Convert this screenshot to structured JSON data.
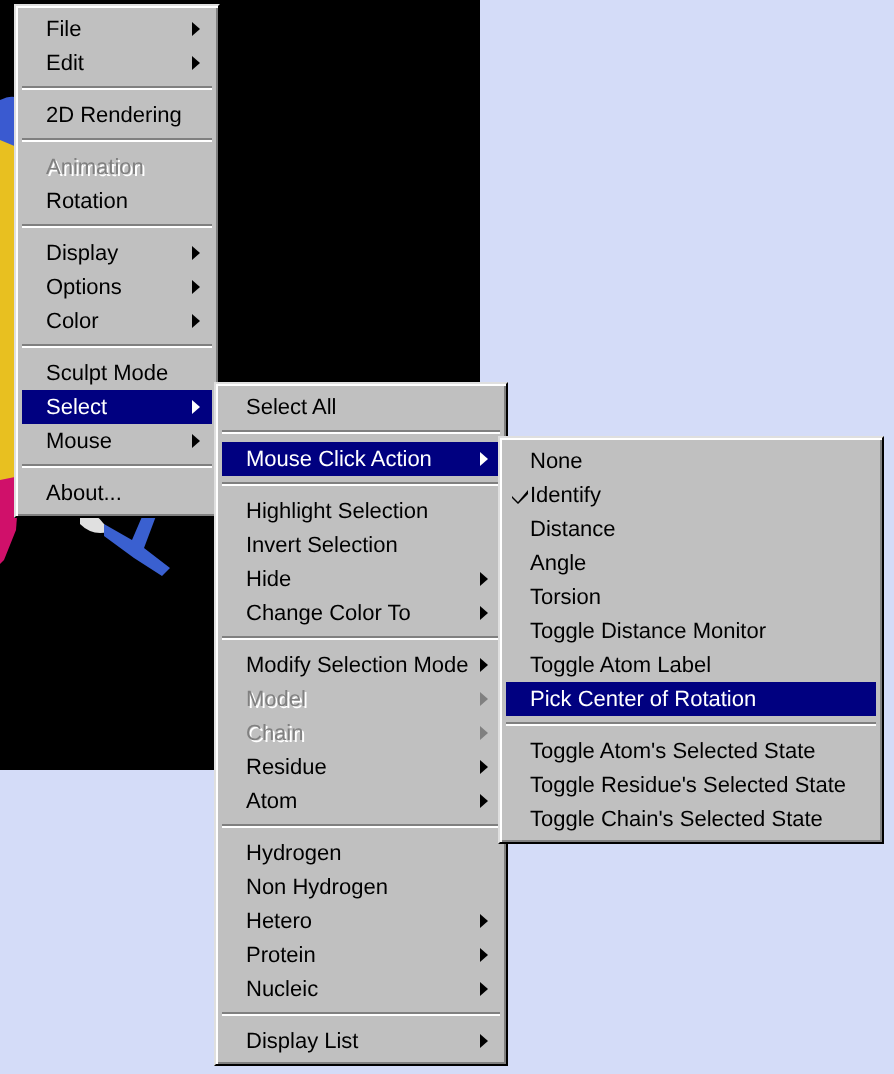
{
  "menus": [
    {
      "items": [
        {
          "kind": "item",
          "label": "File",
          "submenu": true,
          "disabled": false,
          "selected": false
        },
        {
          "kind": "item",
          "label": "Edit",
          "submenu": true,
          "disabled": false,
          "selected": false
        },
        {
          "kind": "separator"
        },
        {
          "kind": "item",
          "label": "2D Rendering",
          "submenu": false,
          "disabled": false,
          "selected": false
        },
        {
          "kind": "separator"
        },
        {
          "kind": "item",
          "label": "Animation",
          "submenu": false,
          "disabled": true,
          "selected": false
        },
        {
          "kind": "item",
          "label": "Rotation",
          "submenu": false,
          "disabled": false,
          "selected": false
        },
        {
          "kind": "separator"
        },
        {
          "kind": "item",
          "label": "Display",
          "submenu": true,
          "disabled": false,
          "selected": false
        },
        {
          "kind": "item",
          "label": "Options",
          "submenu": true,
          "disabled": false,
          "selected": false
        },
        {
          "kind": "item",
          "label": "Color",
          "submenu": true,
          "disabled": false,
          "selected": false
        },
        {
          "kind": "separator"
        },
        {
          "kind": "item",
          "label": "Sculpt Mode",
          "submenu": false,
          "disabled": false,
          "selected": false
        },
        {
          "kind": "item",
          "label": "Select",
          "submenu": true,
          "disabled": false,
          "selected": true
        },
        {
          "kind": "item",
          "label": "Mouse",
          "submenu": true,
          "disabled": false,
          "selected": false
        },
        {
          "kind": "separator"
        },
        {
          "kind": "item",
          "label": "About...",
          "submenu": false,
          "disabled": false,
          "selected": false
        }
      ]
    },
    {
      "items": [
        {
          "kind": "item",
          "label": "Select All",
          "submenu": false,
          "disabled": false,
          "selected": false
        },
        {
          "kind": "separator"
        },
        {
          "kind": "item",
          "label": "Mouse Click Action",
          "submenu": true,
          "disabled": false,
          "selected": true
        },
        {
          "kind": "separator"
        },
        {
          "kind": "item",
          "label": "Highlight Selection",
          "submenu": false,
          "disabled": false,
          "selected": false
        },
        {
          "kind": "item",
          "label": "Invert Selection",
          "submenu": false,
          "disabled": false,
          "selected": false
        },
        {
          "kind": "item",
          "label": "Hide",
          "submenu": true,
          "disabled": false,
          "selected": false
        },
        {
          "kind": "item",
          "label": "Change Color To",
          "submenu": true,
          "disabled": false,
          "selected": false
        },
        {
          "kind": "separator"
        },
        {
          "kind": "item",
          "label": "Modify Selection Mode",
          "submenu": true,
          "disabled": false,
          "selected": false
        },
        {
          "kind": "item",
          "label": "Model",
          "submenu": true,
          "disabled": true,
          "selected": false
        },
        {
          "kind": "item",
          "label": "Chain",
          "submenu": true,
          "disabled": true,
          "selected": false
        },
        {
          "kind": "item",
          "label": "Residue",
          "submenu": true,
          "disabled": false,
          "selected": false
        },
        {
          "kind": "item",
          "label": "Atom",
          "submenu": true,
          "disabled": false,
          "selected": false
        },
        {
          "kind": "separator"
        },
        {
          "kind": "item",
          "label": "Hydrogen",
          "submenu": false,
          "disabled": false,
          "selected": false
        },
        {
          "kind": "item",
          "label": "Non Hydrogen",
          "submenu": false,
          "disabled": false,
          "selected": false
        },
        {
          "kind": "item",
          "label": "Hetero",
          "submenu": true,
          "disabled": false,
          "selected": false
        },
        {
          "kind": "item",
          "label": "Protein",
          "submenu": true,
          "disabled": false,
          "selected": false
        },
        {
          "kind": "item",
          "label": "Nucleic",
          "submenu": true,
          "disabled": false,
          "selected": false
        },
        {
          "kind": "separator"
        },
        {
          "kind": "item",
          "label": "Display List",
          "submenu": true,
          "disabled": false,
          "selected": false
        }
      ]
    },
    {
      "items": [
        {
          "kind": "item",
          "label": "None",
          "checked": false,
          "selected": false
        },
        {
          "kind": "item",
          "label": "Identify",
          "checked": true,
          "selected": false
        },
        {
          "kind": "item",
          "label": "Distance",
          "checked": false,
          "selected": false
        },
        {
          "kind": "item",
          "label": "Angle",
          "checked": false,
          "selected": false
        },
        {
          "kind": "item",
          "label": "Torsion",
          "checked": false,
          "selected": false
        },
        {
          "kind": "item",
          "label": "Toggle Distance Monitor",
          "checked": false,
          "selected": false
        },
        {
          "kind": "item",
          "label": "Toggle Atom Label",
          "checked": false,
          "selected": false
        },
        {
          "kind": "item",
          "label": "Pick Center of Rotation",
          "checked": false,
          "selected": true
        },
        {
          "kind": "separator"
        },
        {
          "kind": "item",
          "label": "Toggle Atom's Selected State",
          "checked": false,
          "selected": false
        },
        {
          "kind": "item",
          "label": "Toggle Residue's Selected State",
          "checked": false,
          "selected": false
        },
        {
          "kind": "item",
          "label": "Toggle Chain's Selected State",
          "checked": false,
          "selected": false
        }
      ]
    }
  ]
}
